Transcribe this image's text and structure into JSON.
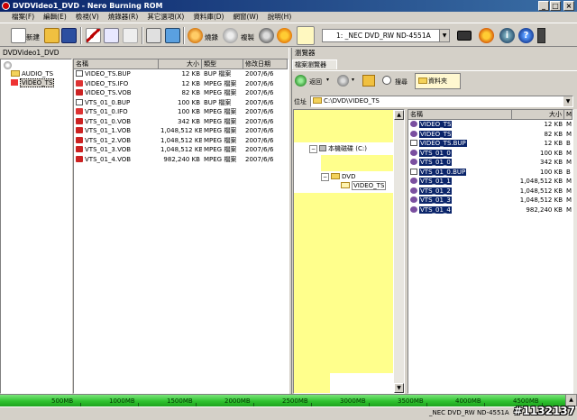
{
  "window": {
    "title": "DVDVideo1_DVD - Nero Burning ROM"
  },
  "menu": [
    "檔案(F)",
    "編輯(E)",
    "檢視(V)",
    "燒錄器(R)",
    "其它選項(X)",
    "資料庫(D)",
    "網窗(W)",
    "說明(H)"
  ],
  "toolbar": {
    "new_label": "新建",
    "burn_label": "燒錄",
    "copy_label": "複製",
    "drive_select": "1: _NEC DVD_RW ND-4551A"
  },
  "left_panel": {
    "title": "DVDVideo1_DVD",
    "tree": [
      "AUDIO_TS",
      "VIDEO_TS"
    ]
  },
  "file_list": {
    "columns": [
      "名稱",
      "大小",
      "類型",
      "修改日期"
    ],
    "rows": [
      {
        "name": "VIDEO_TS.BUP",
        "size": "12 KB",
        "type": "BUP 檔案",
        "date": "2007/6/6",
        "icon": "bup"
      },
      {
        "name": "VIDEO_TS.IFO",
        "size": "12 KB",
        "type": "MPEG 檔案",
        "date": "2007/6/6",
        "icon": "ifo"
      },
      {
        "name": "VIDEO_TS.VOB",
        "size": "82 KB",
        "type": "MPEG 檔案",
        "date": "2007/6/6",
        "icon": "vob"
      },
      {
        "name": "VTS_01_0.BUP",
        "size": "100 KB",
        "type": "BUP 檔案",
        "date": "2007/6/6",
        "icon": "bup"
      },
      {
        "name": "VTS_01_0.IFO",
        "size": "100 KB",
        "type": "MPEG 檔案",
        "date": "2007/6/6",
        "icon": "ifo"
      },
      {
        "name": "VTS_01_0.VOB",
        "size": "342 KB",
        "type": "MPEG 檔案",
        "date": "2007/6/6",
        "icon": "vob"
      },
      {
        "name": "VTS_01_1.VOB",
        "size": "1,048,512 KB",
        "type": "MPEG 檔案",
        "date": "2007/6/6",
        "icon": "vob"
      },
      {
        "name": "VTS_01_2.VOB",
        "size": "1,048,512 KB",
        "type": "MPEG 檔案",
        "date": "2007/6/6",
        "icon": "vob"
      },
      {
        "name": "VTS_01_3.VOB",
        "size": "1,048,512 KB",
        "type": "MPEG 檔案",
        "date": "2007/6/6",
        "icon": "vob"
      },
      {
        "name": "VTS_01_4.VOB",
        "size": "982,240 KB",
        "type": "MPEG 檔案",
        "date": "2007/6/6",
        "icon": "vob"
      }
    ]
  },
  "browser": {
    "title": "瀏覽器",
    "tab": "檔案瀏覽器",
    "back_label": "返回",
    "search_label": "搜尋",
    "folders_label": "資料夾",
    "address_label": "位址",
    "address_value": "C:\\DVD\\VIDEO_TS",
    "tree_computer": "本機磁碟 (C:)",
    "tree_dvd": "DVD",
    "tree_video": "VIDEO_TS",
    "columns": [
      "名稱",
      "大小",
      "M"
    ],
    "rows": [
      {
        "name": "VIDEO_TS",
        "size": "12 KB",
        "m": "M"
      },
      {
        "name": "VIDEO_TS",
        "size": "82 KB",
        "m": "M"
      },
      {
        "name": "VIDEO_TS.BUP",
        "size": "12 KB",
        "m": "B"
      },
      {
        "name": "VTS_01_0",
        "size": "100 KB",
        "m": "M"
      },
      {
        "name": "VTS_01_0",
        "size": "342 KB",
        "m": "M"
      },
      {
        "name": "VTS_01_0.BUP",
        "size": "100 KB",
        "m": "B"
      },
      {
        "name": "VTS_01_1",
        "size": "1,048,512 KB",
        "m": "M"
      },
      {
        "name": "VTS_01_2",
        "size": "1,048,512 KB",
        "m": "M"
      },
      {
        "name": "VTS_01_3",
        "size": "1,048,512 KB",
        "m": "M"
      },
      {
        "name": "VTS_01_4",
        "size": "982,240 KB",
        "m": "M"
      }
    ]
  },
  "capacity": {
    "ticks": [
      "500MB",
      "1000MB",
      "1500MB",
      "2000MB",
      "2500MB",
      "3000MB",
      "3500MB",
      "4000MB",
      "4500MB"
    ]
  },
  "status": {
    "drive": "_NEC   DVD_RW ND-4551A"
  },
  "watermark": "#1132137"
}
